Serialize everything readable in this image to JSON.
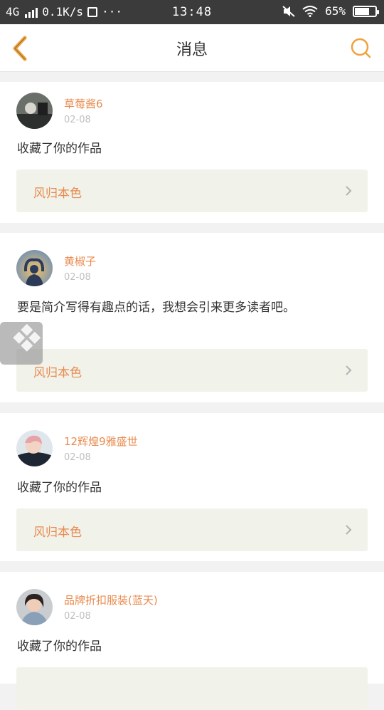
{
  "status_bar": {
    "network": "4G",
    "speed": "0.1K/s",
    "more": "···",
    "time": "13:48",
    "battery": "65%"
  },
  "header": {
    "title": "消息",
    "back_icon": "chevron-left-icon",
    "search_icon": "search-icon",
    "accent_color": "#f0a23c"
  },
  "messages": [
    {
      "username": "草莓酱6",
      "date": "02-08",
      "text": "收藏了你的作品",
      "work_title": "风归本色"
    },
    {
      "username": "黄椒子",
      "date": "02-08",
      "text": "要是简介写得有趣点的话，我想会引来更多读者吧。",
      "work_title": "风归本色"
    },
    {
      "username": "12辉煌9雅盛世",
      "date": "02-08",
      "text": "收藏了你的作品",
      "work_title": "风归本色"
    },
    {
      "username": "品牌折扣服装(蓝天)",
      "date": "02-08",
      "text": "收藏了你的作品",
      "work_title": ""
    }
  ],
  "colors": {
    "username": "#e88b4f",
    "work_box": "#f1f2ea",
    "status_bar": "#3b3b3b"
  }
}
